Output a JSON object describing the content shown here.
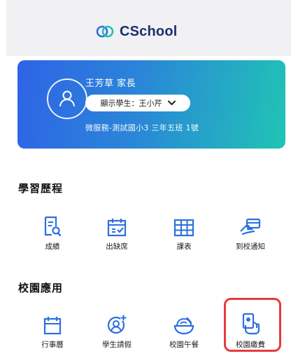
{
  "app": {
    "name": "CSchool"
  },
  "profile": {
    "parent_name": "王芳草 家長",
    "student_label": "顯示學生：王小芹",
    "school_info": "微服務-測試國小3 三年五班 1號"
  },
  "sections": [
    {
      "title": "學習歷程",
      "items": [
        {
          "label": "成績",
          "icon": "report-icon"
        },
        {
          "label": "出缺席",
          "icon": "attendance-calendar-icon"
        },
        {
          "label": "課表",
          "icon": "timetable-grid-icon"
        },
        {
          "label": "到校通知",
          "icon": "hand-card-icon"
        }
      ]
    },
    {
      "title": "校園應用",
      "items": [
        {
          "label": "行事曆",
          "icon": "calendar-icon"
        },
        {
          "label": "學生請假",
          "icon": "add-person-icon"
        },
        {
          "label": "校園午餐",
          "icon": "lunch-bowl-icon"
        },
        {
          "label": "校園繳費",
          "icon": "payment-phone-icon"
        }
      ]
    }
  ],
  "colors": {
    "accent": "#2b6fe0",
    "card_gradient_start": "#2f63e6",
    "card_gradient_end": "#20c4b5",
    "highlight": "#e63b3b"
  }
}
